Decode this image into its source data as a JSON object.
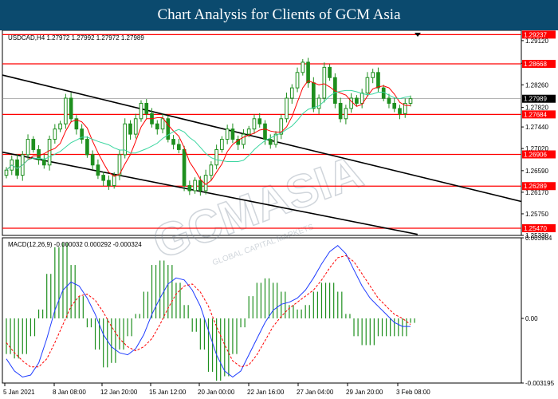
{
  "header": {
    "title": "Chart Analysis for Clients of GCM Asia"
  },
  "watermark": {
    "text": "GCMASIA",
    "subtext": "GLOBAL CAPITAL MARKETS"
  },
  "colors": {
    "banner": "#0b4a6e",
    "candle_up": "#1e8f1e",
    "candle_down": "#1e8f1e",
    "level_line": "#ff0000",
    "level_label_bg": "#ff0000",
    "price_label_bg": "#000000",
    "ma_fast": "#ff0000",
    "ma_slow": "#3cd6a0",
    "channel": "#000000",
    "macd_line": "#1f3cff",
    "signal_line": "#ff0000",
    "histogram": "#1e8f1e"
  },
  "chart_data": [
    {
      "type": "candlestick",
      "symbol_info": "USDCAD,H4  1.27972 1.27992 1.27972 1.27989",
      "current_price": "1.27989",
      "ylim": [
        1.2533,
        1.2932
      ],
      "y_ticks": [
        "1.29120",
        "1.28680",
        "1.28260",
        "1.27820",
        "1.27440",
        "1.27020",
        "1.26590",
        "1.26170",
        "1.25750",
        "1.25330"
      ],
      "x_ticks": [
        "5 Jan 2021",
        "8 Jan 08:00",
        "12 Jan 20:00",
        "15 Jan 12:00",
        "20 Jan 00:00",
        "22 Jan 16:00",
        "27 Jan 04:00",
        "29 Jan 20:00",
        "3 Feb 08:00"
      ],
      "levels": [
        "1.29237",
        "1.28668",
        "1.27684",
        "1.26906",
        "1.26289",
        "1.25470"
      ],
      "trend_channel": {
        "upper": [
          [
            0,
            1.2845
          ],
          [
            100,
            1.2599
          ]
        ],
        "lower": [
          [
            0,
            1.2695
          ],
          [
            80,
            1.2535
          ]
        ]
      },
      "closes": [
        1.266,
        1.268,
        1.265,
        1.269,
        1.272,
        1.27,
        1.268,
        1.267,
        1.272,
        1.274,
        1.275,
        1.28,
        1.276,
        1.274,
        1.272,
        1.269,
        1.267,
        1.265,
        1.264,
        1.263,
        1.265,
        1.269,
        1.275,
        1.273,
        1.276,
        1.279,
        1.277,
        1.275,
        1.274,
        1.276,
        1.272,
        1.271,
        1.27,
        1.263,
        1.262,
        1.264,
        1.262,
        1.265,
        1.267,
        1.27,
        1.272,
        1.274,
        1.272,
        1.271,
        1.273,
        1.274,
        1.276,
        1.275,
        1.272,
        1.271,
        1.273,
        1.276,
        1.28,
        1.282,
        1.285,
        1.287,
        1.283,
        1.278,
        1.28,
        1.286,
        1.284,
        1.279,
        1.276,
        1.278,
        1.28,
        1.279,
        1.281,
        1.284,
        1.285,
        1.282,
        1.28,
        1.279,
        1.278,
        1.277,
        1.279,
        1.2799
      ],
      "macd": {
        "label": "MACD(12,26,9) -0.000032 0.000292 -0.000324",
        "ylim": [
          -0.003195,
          0.003984
        ],
        "y_ticks": [
          "0.003984",
          "0.00",
          "-0.003195"
        ],
        "macd_values": [
          -0.002,
          -0.0026,
          -0.0029,
          -0.0028,
          -0.0022,
          -0.001,
          0.0004,
          0.0014,
          0.0018,
          0.0016,
          0.001,
          0.0002,
          -0.0008,
          -0.0014,
          -0.0017,
          -0.0018,
          -0.0015,
          -0.0008,
          0.0002,
          0.001,
          0.0017,
          0.002,
          0.0019,
          0.0014,
          0.0006,
          -0.0006,
          -0.0018,
          -0.0026,
          -0.0029,
          -0.0026,
          -0.0018,
          -0.001,
          -0.0002,
          0.0004,
          0.0007,
          0.0008,
          0.001,
          0.0014,
          0.002,
          0.0027,
          0.0033,
          0.0036,
          0.0032,
          0.0024,
          0.0016,
          0.001,
          0.0006,
          0.0002,
          -0.0002,
          -0.0004,
          -0.0004
        ],
        "signal_values": [
          -0.0012,
          -0.0017,
          -0.0021,
          -0.0024,
          -0.0024,
          -0.002,
          -0.0012,
          -0.0003,
          0.0006,
          0.0011,
          0.0012,
          0.0009,
          0.0003,
          -0.0004,
          -0.001,
          -0.0014,
          -0.0016,
          -0.0014,
          -0.001,
          -0.0003,
          0.0005,
          0.0012,
          0.0016,
          0.0017,
          0.0013,
          0.0006,
          -0.0004,
          -0.0013,
          -0.0021,
          -0.0024,
          -0.0023,
          -0.0018,
          -0.0011,
          -0.0004,
          0.0001,
          0.0005,
          0.0008,
          0.0011,
          0.0014,
          0.0019,
          0.0025,
          0.003,
          0.0031,
          0.0028,
          0.0022,
          0.0016,
          0.001,
          0.0006,
          0.0002,
          0.0,
          -0.0003
        ]
      }
    }
  ]
}
